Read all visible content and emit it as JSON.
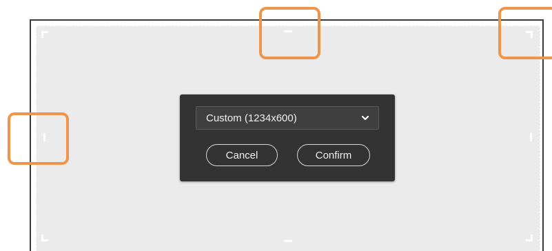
{
  "dialog": {
    "size_select": {
      "value": "Custom (1234x600)",
      "icon": "chevron-down-icon"
    },
    "cancel_label": "Cancel",
    "confirm_label": "Confirm"
  },
  "colors": {
    "highlight": "#f0944a",
    "dialog_bg": "#333333",
    "crop_area_bg": "#ebebeb"
  }
}
